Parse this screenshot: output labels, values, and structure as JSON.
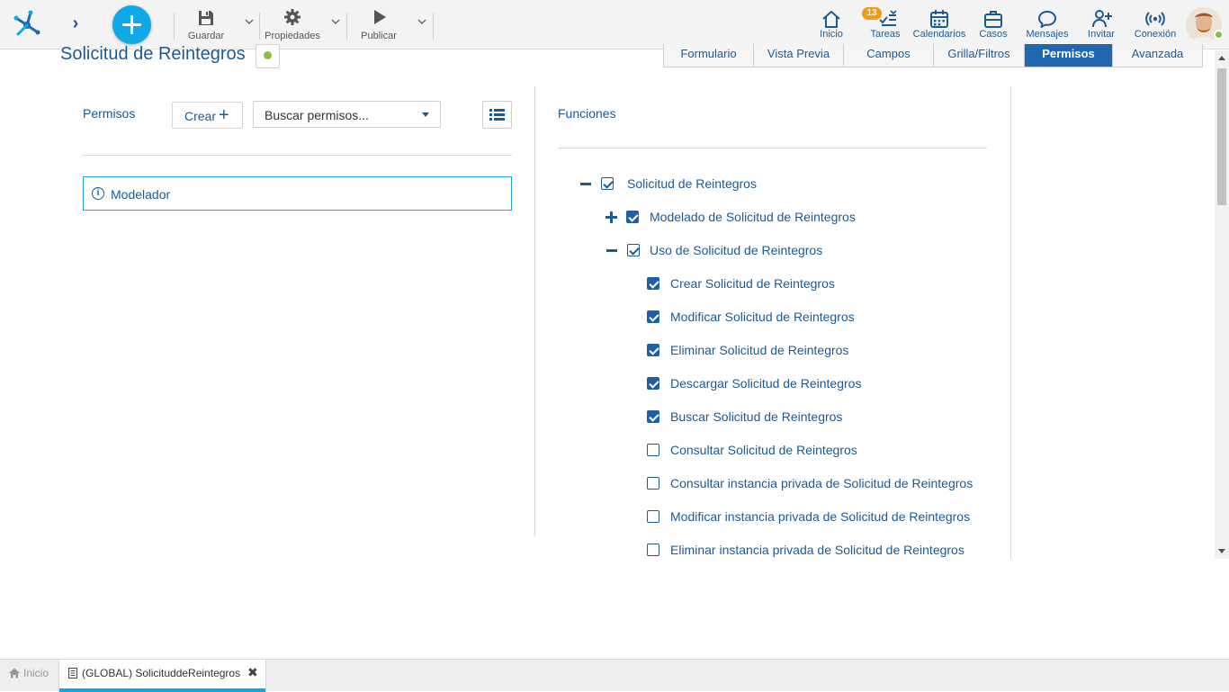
{
  "toolbar": {
    "guardar": "Guardar",
    "propiedades": "Propiedades",
    "publicar": "Publicar"
  },
  "nav": {
    "inicio": "Inicio",
    "tareas": "Tareas",
    "tareas_badge": "13",
    "calendarios": "Calendarios",
    "casos": "Casos",
    "mensajes": "Mensajes",
    "invitar": "Invitar",
    "conexion": "Conexión"
  },
  "page": {
    "title": "Solicitud de Reintegros",
    "status_color": "#8bbf3a"
  },
  "tabs": [
    {
      "label": "Formulario",
      "active": false
    },
    {
      "label": "Vista Previa",
      "active": false
    },
    {
      "label": "Campos",
      "active": false
    },
    {
      "label": "Grilla/Filtros",
      "active": false
    },
    {
      "label": "Permisos",
      "active": true
    },
    {
      "label": "Avanzada",
      "active": false
    }
  ],
  "permisos": {
    "label": "Permisos",
    "crear_label": "Crear",
    "search_placeholder": "Buscar permisos...",
    "items": [
      {
        "label": "Modelador"
      }
    ]
  },
  "funciones": {
    "label": "Funciones",
    "tree": [
      {
        "label": "Solicitud de Reintegros",
        "toggle": "minus",
        "state": "partial"
      },
      {
        "label": "Modelado de Solicitud de Reintegros",
        "toggle": "plus",
        "state": "checked"
      },
      {
        "label": "Uso de Solicitud de Reintegros",
        "toggle": "minus",
        "state": "partial"
      },
      {
        "label": "Crear Solicitud de Reintegros",
        "state": "checked"
      },
      {
        "label": "Modificar Solicitud de Reintegros",
        "state": "checked"
      },
      {
        "label": "Eliminar Solicitud de Reintegros",
        "state": "checked"
      },
      {
        "label": "Descargar Solicitud de Reintegros",
        "state": "checked"
      },
      {
        "label": "Buscar Solicitud de Reintegros",
        "state": "checked"
      },
      {
        "label": "Consultar Solicitud de Reintegros",
        "state": "unchecked"
      },
      {
        "label": "Consultar instancia privada de Solicitud de Reintegros",
        "state": "unchecked"
      },
      {
        "label": "Modificar instancia privada de Solicitud de Reintegros",
        "state": "unchecked"
      },
      {
        "label": "Eliminar instancia privada de Solicitud de Reintegros",
        "state": "unchecked"
      }
    ]
  },
  "bottom_tabs": {
    "home": "Inicio",
    "active": "(GLOBAL) SolicituddeReintegros"
  },
  "colors": {
    "accent": "#11a8e8",
    "primary_text": "#1a5b96",
    "active_tab": "#1f68b1",
    "badge": "#f39c12"
  }
}
